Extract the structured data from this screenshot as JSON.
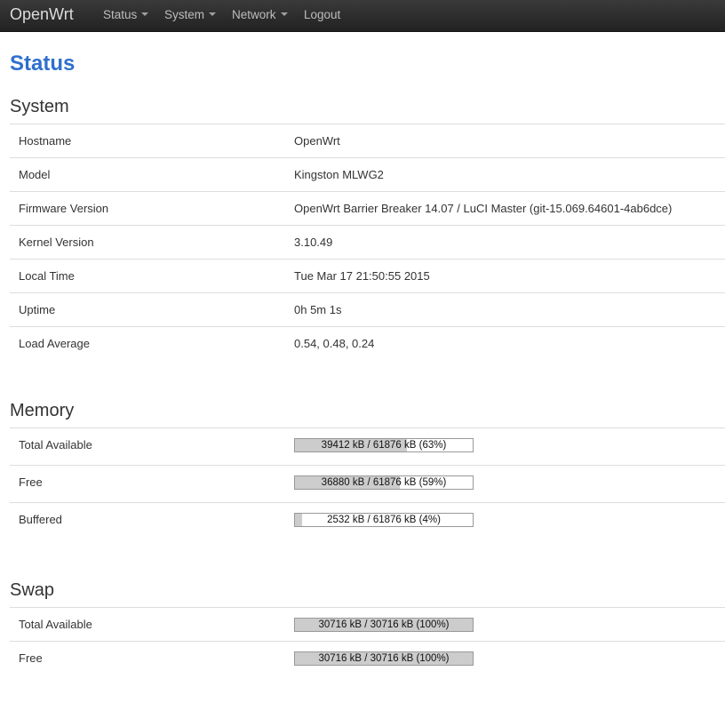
{
  "navbar": {
    "brand": "OpenWrt",
    "items": [
      {
        "label": "Status",
        "dropdown": true
      },
      {
        "label": "System",
        "dropdown": true
      },
      {
        "label": "Network",
        "dropdown": true
      },
      {
        "label": "Logout",
        "dropdown": false
      }
    ]
  },
  "page_title": "Status",
  "system": {
    "title": "System",
    "rows": [
      {
        "label": "Hostname",
        "value": "OpenWrt"
      },
      {
        "label": "Model",
        "value": "Kingston MLWG2"
      },
      {
        "label": "Firmware Version",
        "value": "OpenWrt Barrier Breaker 14.07 / LuCI Master (git-15.069.64601-4ab6dce)"
      },
      {
        "label": "Kernel Version",
        "value": "3.10.49"
      },
      {
        "label": "Local Time",
        "value": "Tue Mar 17 21:50:55 2015"
      },
      {
        "label": "Uptime",
        "value": "0h 5m 1s"
      },
      {
        "label": "Load Average",
        "value": "0.54, 0.48, 0.24"
      }
    ]
  },
  "memory": {
    "title": "Memory",
    "rows": [
      {
        "label": "Total Available",
        "bar_text": "39412 kB / 61876 kB (63%)",
        "percent": 63
      },
      {
        "label": "Free",
        "bar_text": "36880 kB / 61876 kB (59%)",
        "percent": 59
      },
      {
        "label": "Buffered",
        "bar_text": "2532 kB / 61876 kB (4%)",
        "percent": 4
      }
    ]
  },
  "swap": {
    "title": "Swap",
    "rows": [
      {
        "label": "Total Available",
        "bar_text": "30716 kB / 30716 kB (100%)",
        "percent": 100
      },
      {
        "label": "Free",
        "bar_text": "30716 kB / 30716 kB (100%)",
        "percent": 100
      }
    ]
  },
  "colors": {
    "navbar_bg": "#2a2a2a",
    "title_blue": "#2f6fce",
    "bar_fill": "#cccccc"
  }
}
